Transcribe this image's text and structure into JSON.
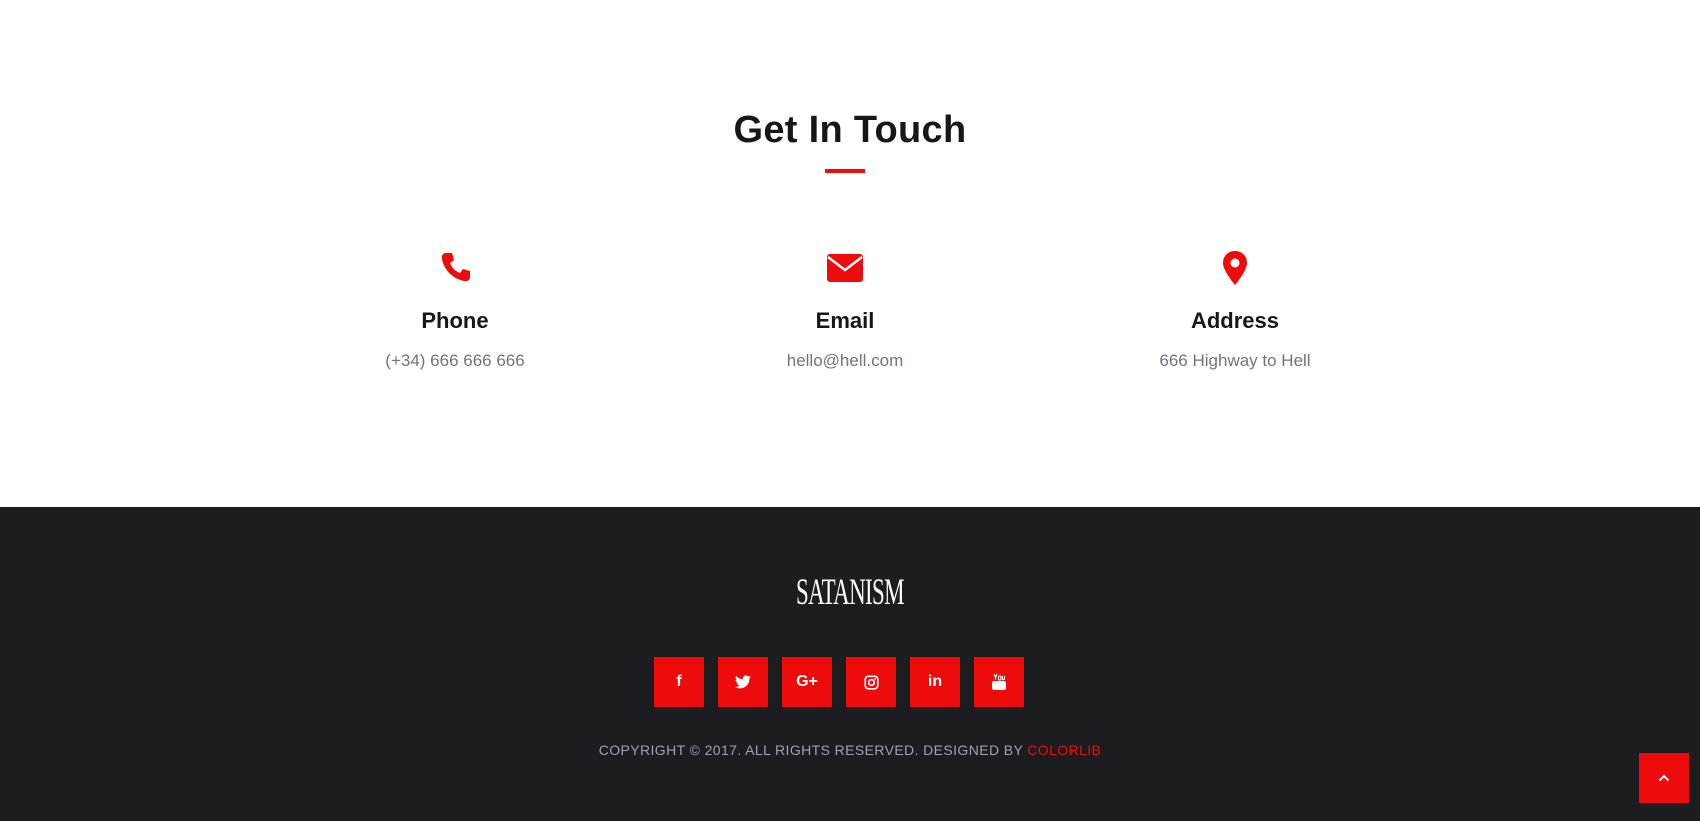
{
  "contact": {
    "title": "Get In Touch",
    "items": [
      {
        "icon": "phone-icon",
        "label": "Phone",
        "value": "(+34) 666 666 666"
      },
      {
        "icon": "envelope-icon",
        "label": "Email",
        "value": "hello@hell.com"
      },
      {
        "icon": "map-marker-icon",
        "label": "Address",
        "value": "666 Highway to Hell"
      }
    ]
  },
  "footer": {
    "logo": "SATANISM",
    "socials": [
      {
        "icon": "facebook-icon",
        "glyph": "f"
      },
      {
        "icon": "twitter-icon",
        "glyph": ""
      },
      {
        "icon": "google-plus-icon",
        "glyph": "G+"
      },
      {
        "icon": "instagram-icon",
        "glyph": ""
      },
      {
        "icon": "linkedin-icon",
        "glyph": "in"
      },
      {
        "icon": "youtube-icon",
        "glyph": ""
      }
    ],
    "copyright_text": "COPYRIGHT © 2017. ALL RIGHTS RESERVED. DESIGNED BY",
    "copyright_link": "COLORLIB"
  },
  "colors": {
    "accent": "#ee0b0b",
    "footer_bg": "#1c1d21",
    "heading": "#16171b",
    "muted": "#6e7484"
  },
  "back_to_top": {
    "icon": "chevron-up-icon"
  }
}
